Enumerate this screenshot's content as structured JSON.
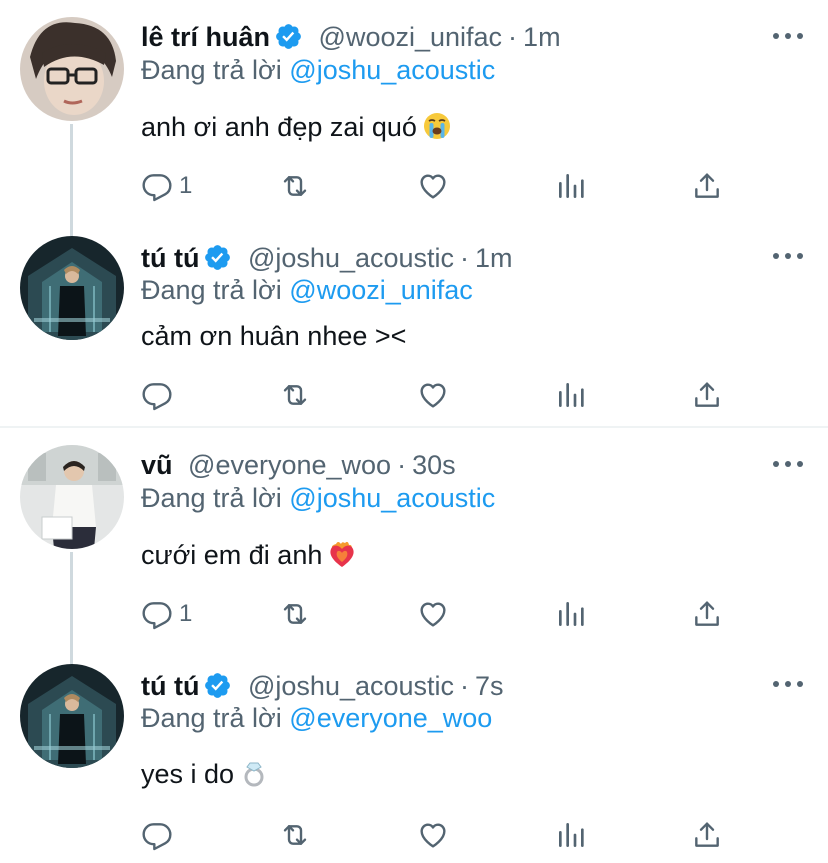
{
  "colors": {
    "accent": "#1d9bf0",
    "secondary_text": "#536471",
    "thread_line": "#cfd9de"
  },
  "replying_prefix": "Đang trả lời",
  "tweets": [
    {
      "name": "lê trí huân",
      "verified": true,
      "handle": "@woozi_unifac",
      "dot": "·",
      "time": "1m",
      "replying_to": "@joshu_acoustic",
      "text": "anh ơi anh đẹp zai quó",
      "emoji": "loudly-crying-face",
      "reply_count": "1"
    },
    {
      "name": "tú tú",
      "verified": true,
      "handle": "@joshu_acoustic",
      "dot": "·",
      "time": "1m",
      "replying_to": "@woozi_unifac",
      "text": "cảm ơn huân nhee ><",
      "emoji": "",
      "reply_count": ""
    },
    {
      "name": "vũ",
      "verified": false,
      "handle": "@everyone_woo",
      "dot": "·",
      "time": "30s",
      "replying_to": "@joshu_acoustic",
      "text": "cưới em đi anh",
      "emoji": "heart-on-fire",
      "reply_count": "1"
    },
    {
      "name": "tú tú",
      "verified": true,
      "handle": "@joshu_acoustic",
      "dot": "·",
      "time": "7s",
      "replying_to": "@everyone_woo",
      "text": "yes i do",
      "emoji": "ring",
      "reply_count": ""
    }
  ]
}
